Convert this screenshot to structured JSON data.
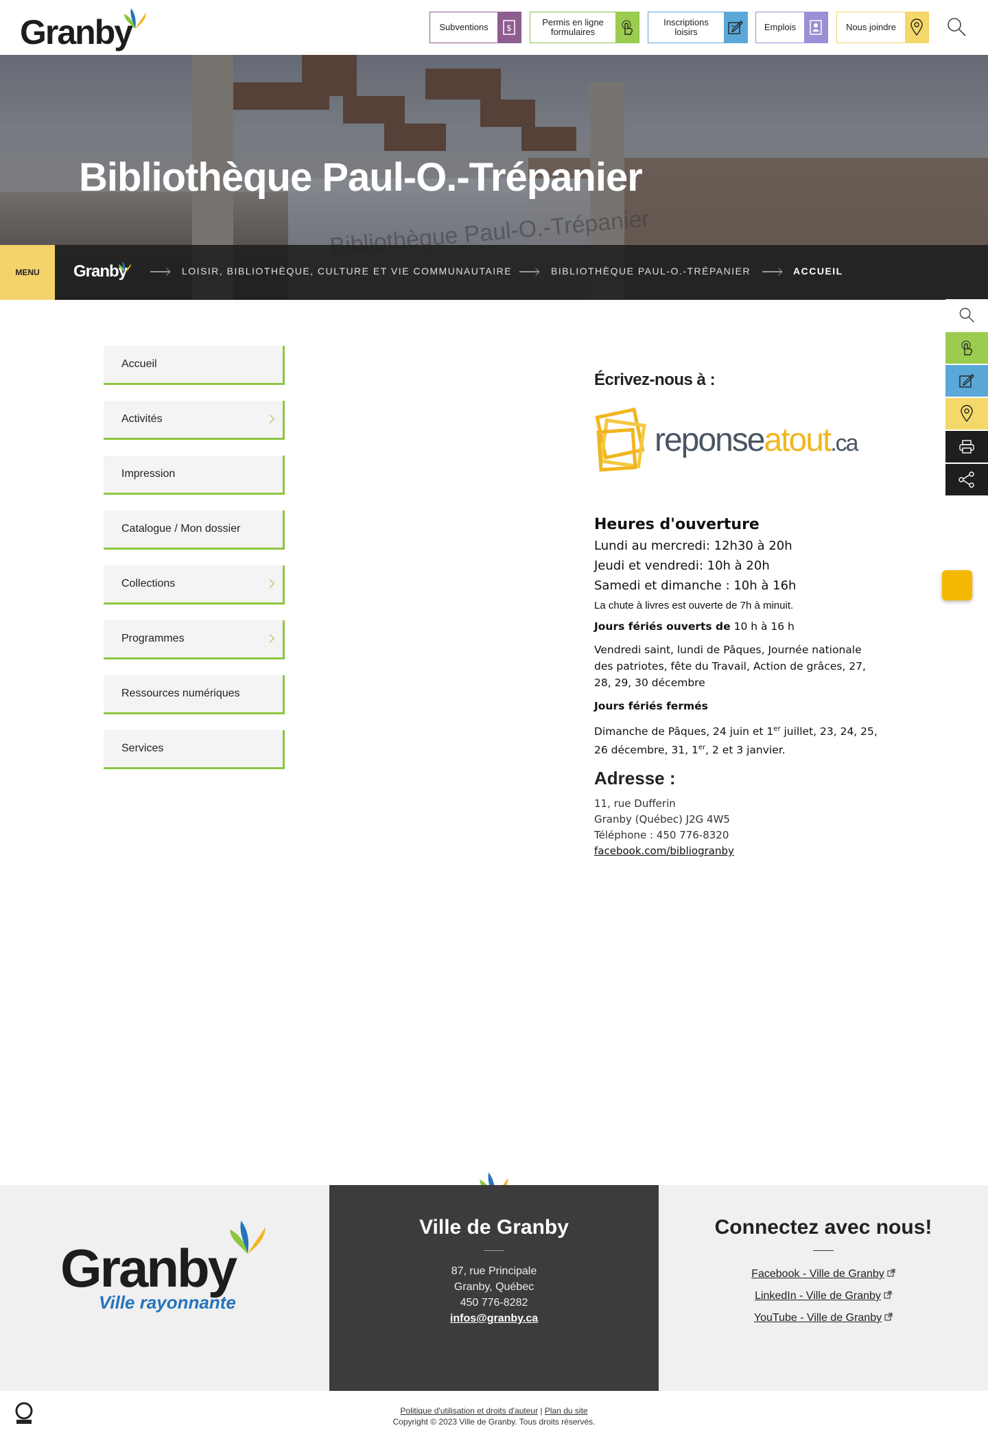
{
  "header": {
    "logo_text": "Granby",
    "quick_links": [
      {
        "label": "Subventions",
        "icon": "dollar-doc-icon",
        "color": "#8f5d8f"
      },
      {
        "label": "Permis en ligne formulaires",
        "icon": "pointer-click-icon",
        "color": "#9ccc4f"
      },
      {
        "label": "Inscriptions loisirs",
        "icon": "edit-form-icon",
        "color": "#5aa7d8"
      },
      {
        "label": "Emplois",
        "icon": "id-card-icon",
        "color": "#9c8fd6"
      },
      {
        "label": "Nous joindre",
        "icon": "location-pin-icon",
        "color": "#f5d86a"
      }
    ],
    "search_icon": "search-icon"
  },
  "hero": {
    "title": "Bibliothèque Paul-O.-Trépanier",
    "glass_text": "Bibliothèque Paul-O.-Trépanier"
  },
  "breadcrumb": {
    "menu_label": "MENU",
    "home_logo": "Granby",
    "items": [
      "LOISIR, BIBLIOTHÈQUE, CULTURE ET VIE COMMUNAUTAIRE",
      "BIBLIOTHÈQUE PAUL-O.-TRÉPANIER",
      "ACCUEIL"
    ]
  },
  "sidenav": {
    "items": [
      {
        "label": "Accueil",
        "has_children": false
      },
      {
        "label": "Activités",
        "has_children": true
      },
      {
        "label": "Impression",
        "has_children": false
      },
      {
        "label": "Catalogue / Mon dossier",
        "has_children": false
      },
      {
        "label": "Collections",
        "has_children": true
      },
      {
        "label": "Programmes",
        "has_children": true
      },
      {
        "label": "Ressources numériques",
        "has_children": false
      },
      {
        "label": "Services",
        "has_children": false
      }
    ]
  },
  "content": {
    "write_title": "Écrivez-nous à :",
    "reponseatout": {
      "part1": "reponse",
      "part2": "atout",
      "part3": ".ca"
    },
    "hours_title": "Heures d'ouverture",
    "hours": [
      "Lundi au mercredi: 12h30 à 20h",
      "Jeudi et vendredi: 10h à 20h",
      "Samedi et dimanche : 10h à 16h"
    ],
    "drop_note": "La chute à livres est ouverte de 7h à minuit.",
    "holidays_open_label": "Jours fériés ouverts de",
    "holidays_open_hours": " 10 h à 16 h",
    "holidays_open_list": "Vendredi saint, lundi de Pâques, Journée nationale des patriotes, fête du Travail, Action de grâces, 27, 28, 29, 30 décembre",
    "holidays_closed_label": "Jours fériés fermés",
    "holidays_closed_a": "Dimanche de Pâques, 24 juin et 1",
    "holidays_closed_sup1": "er",
    "holidays_closed_b": " juillet, 23, 24, 25, 26 décembre, 31, 1",
    "holidays_closed_sup2": "er",
    "holidays_closed_c": ", 2 et 3 janvier.",
    "address_title": "Adresse :",
    "address_lines": [
      "11, rue Dufferin",
      "Granby (Québec) J2G 4W5",
      "Téléphone : 450 776-8320"
    ],
    "facebook_link": "facebook.com/bibliogranby"
  },
  "right_toolbar": [
    {
      "icon": "search-icon",
      "color": "#ffffff"
    },
    {
      "icon": "pointer-click-icon",
      "color": "#9ccc4f"
    },
    {
      "icon": "edit-form-icon",
      "color": "#5aa7d8"
    },
    {
      "icon": "location-pin-icon",
      "color": "#f5d86a"
    },
    {
      "icon": "print-icon",
      "color": "#1e1e1e"
    },
    {
      "icon": "share-icon",
      "color": "#1e1e1e"
    }
  ],
  "footer": {
    "logo_text": "Granby",
    "logo_tagline": "Ville rayonnante",
    "city_title": "Ville de Granby",
    "city_lines": [
      "87, rue Principale",
      "Granby, Québec",
      "450 776-8282"
    ],
    "city_email": "infos@granby.ca",
    "social_title": "Connectez avec nous!",
    "social_links": [
      "Facebook - Ville de Granby",
      "LinkedIn - Ville de Granby",
      "YouTube - Ville de Granby"
    ],
    "legal_link1": "Politique d'utilisation et droits d'auteur",
    "legal_sep": " | ",
    "legal_link2": "Plan du site",
    "copyright": "Copyright © 2023 Ville de Granby. Tous droits réservés."
  },
  "colors": {
    "accent_green": "#8cc63f",
    "accent_yellow": "#f5d36b",
    "dark": "#3c3c3c"
  }
}
